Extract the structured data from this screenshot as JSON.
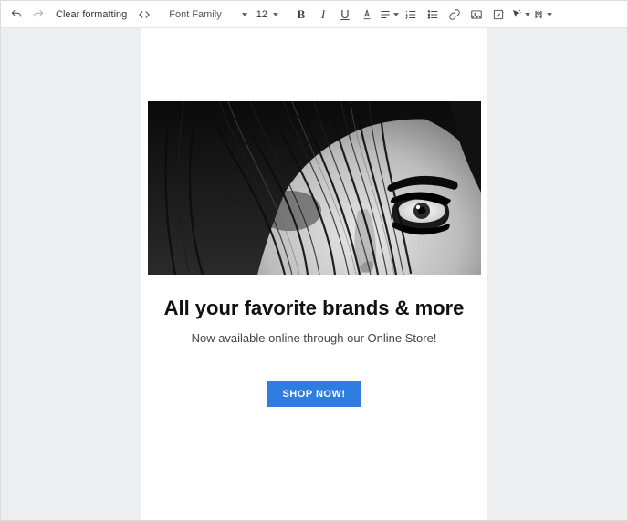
{
  "toolbar": {
    "clear_formatting": "Clear formatting",
    "font_family_label": "Font Family",
    "font_size": "12"
  },
  "content": {
    "headline": "All your favorite brands & more",
    "subline": "Now available online through our Online Store!",
    "cta_label": "SHOP NOW!"
  }
}
